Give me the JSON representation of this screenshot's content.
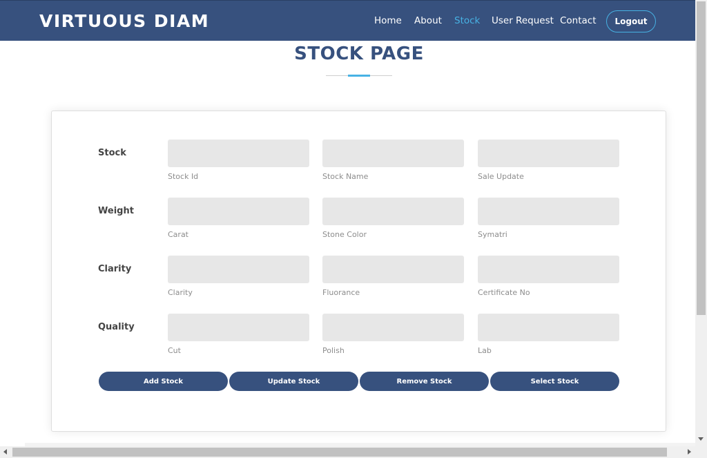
{
  "brand": {
    "name": "VIRTUOUS DIAM"
  },
  "nav": {
    "items": [
      {
        "label": "Home",
        "active": false
      },
      {
        "label": "About",
        "active": false
      },
      {
        "label": "Stock",
        "active": true
      },
      {
        "label": "User Request",
        "active": false
      },
      {
        "label": "Contact",
        "active": false
      }
    ],
    "logout_label": "Logout"
  },
  "page": {
    "title": "STOCK PAGE"
  },
  "form": {
    "rows": [
      {
        "label": "Stock",
        "fields": [
          {
            "help": "Stock Id",
            "value": ""
          },
          {
            "help": "Stock Name",
            "value": ""
          },
          {
            "help": "Sale Update",
            "value": ""
          }
        ]
      },
      {
        "label": "Weight",
        "fields": [
          {
            "help": "Carat",
            "value": ""
          },
          {
            "help": "Stone Color",
            "value": ""
          },
          {
            "help": "Symatri",
            "value": ""
          }
        ]
      },
      {
        "label": "Clarity",
        "fields": [
          {
            "help": "Clarity",
            "value": ""
          },
          {
            "help": "Fluorance",
            "value": ""
          },
          {
            "help": "Certificate No",
            "value": ""
          }
        ]
      },
      {
        "label": "Quality",
        "fields": [
          {
            "help": "Cut",
            "value": ""
          },
          {
            "help": "Polish",
            "value": ""
          },
          {
            "help": "Lab",
            "value": ""
          }
        ]
      }
    ],
    "buttons": [
      {
        "label": "Add Stock"
      },
      {
        "label": "Update Stock"
      },
      {
        "label": "Remove Stock"
      },
      {
        "label": "Select Stock"
      }
    ]
  },
  "colors": {
    "brand": "#37517e",
    "accent": "#47b2e4",
    "field_bg": "#e7e7e7"
  }
}
